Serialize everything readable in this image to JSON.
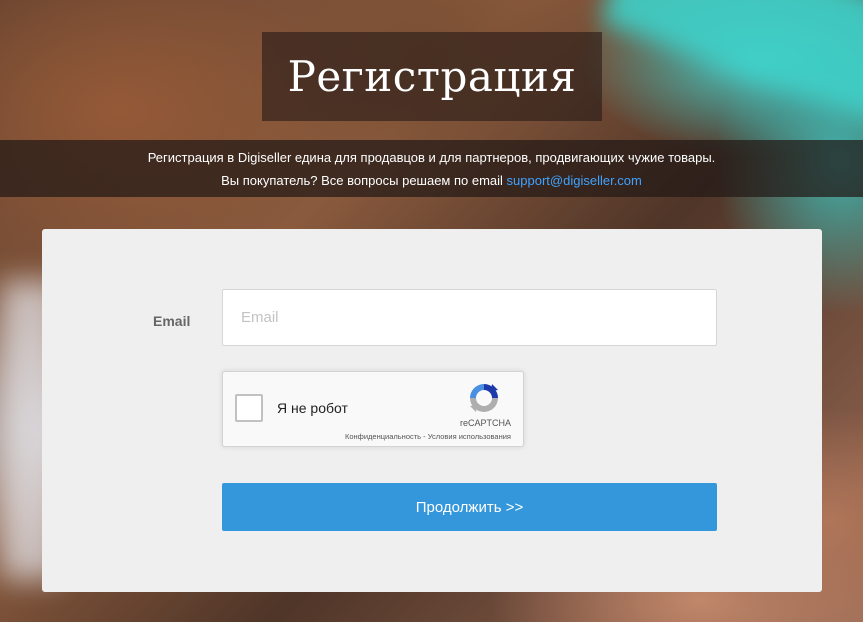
{
  "page": {
    "title": "Регистрация"
  },
  "info": {
    "line1": "Регистрация в Digiseller едина для продавцов и для партнеров, продвигающих чужие товары.",
    "line2_prefix": "Вы покупатель? Все вопросы решаем по email ",
    "support_email": "support@digiseller.com"
  },
  "form": {
    "email_label": "Email",
    "email_placeholder": "Email",
    "email_value": "",
    "recaptcha": {
      "checkbox_label": "Я не робот",
      "brand": "reCAPTCHA",
      "privacy_link": "Конфиденциальность",
      "separator": " - ",
      "terms_link": "Условия использования",
      "logo_icon": "recaptcha-logo-icon"
    },
    "submit_label": "Продолжить >>"
  },
  "colors": {
    "accent_button": "#3597db",
    "link": "#3fa3ff",
    "card_background": "#efefef"
  }
}
